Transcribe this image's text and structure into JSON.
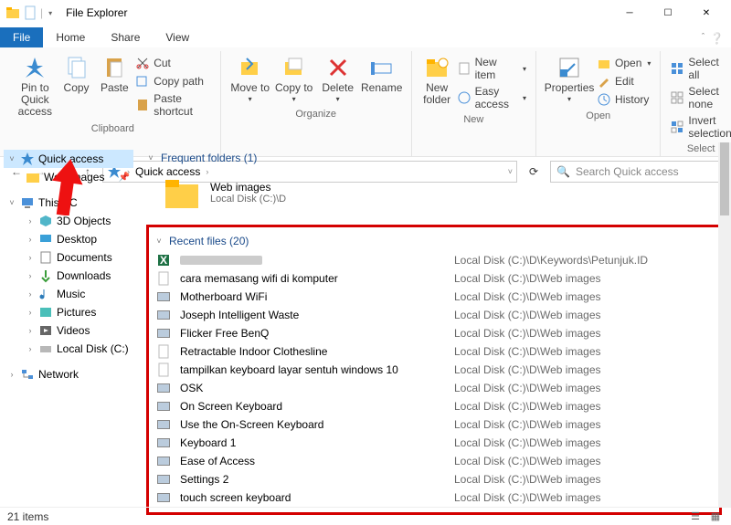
{
  "window": {
    "title": "File Explorer"
  },
  "tabs": {
    "file": "File",
    "home": "Home",
    "share": "Share",
    "view": "View"
  },
  "ribbon": {
    "clipboard": {
      "label": "Clipboard",
      "pin": "Pin to Quick access",
      "copy": "Copy",
      "paste": "Paste",
      "cut": "Cut",
      "copypath": "Copy path",
      "pasteshortcut": "Paste shortcut"
    },
    "organize": {
      "label": "Organize",
      "moveto": "Move to",
      "copyto": "Copy to",
      "delete": "Delete",
      "rename": "Rename"
    },
    "new": {
      "label": "New",
      "newfolder": "New folder",
      "newitem": "New item",
      "easyaccess": "Easy access"
    },
    "open": {
      "label": "Open",
      "properties": "Properties",
      "open": "Open",
      "edit": "Edit",
      "history": "History"
    },
    "select": {
      "label": "Select",
      "selectall": "Select all",
      "selectnone": "Select none",
      "invert": "Invert selection"
    }
  },
  "address": {
    "crumb1": "Quick access"
  },
  "search": {
    "placeholder": "Search Quick access"
  },
  "sidebar": {
    "quickaccess": "Quick access",
    "webimages": "Web images",
    "thispc": "This PC",
    "obj3d": "3D Objects",
    "desktop": "Desktop",
    "documents": "Documents",
    "downloads": "Downloads",
    "music": "Music",
    "pictures": "Pictures",
    "videos": "Videos",
    "localdisk": "Local Disk (C:)",
    "network": "Network"
  },
  "frequent": {
    "header": "Frequent folders (1)",
    "items": [
      {
        "name": "Web images",
        "path": "Local Disk (C:)\\D"
      }
    ]
  },
  "recent": {
    "header": "Recent files (20)",
    "items": [
      {
        "name": "",
        "path": "Local Disk (C:)\\D\\Keywords\\Petunjuk.ID",
        "type": "excel",
        "blurred": true
      },
      {
        "name": "cara memasang wifi di komputer",
        "path": "Local Disk (C:)\\D\\Web images",
        "type": "doc"
      },
      {
        "name": "Motherboard WiFi",
        "path": "Local Disk (C:)\\D\\Web images",
        "type": "img"
      },
      {
        "name": "Joseph Intelligent Waste",
        "path": "Local Disk (C:)\\D\\Web images",
        "type": "img"
      },
      {
        "name": "Flicker Free BenQ",
        "path": "Local Disk (C:)\\D\\Web images",
        "type": "img"
      },
      {
        "name": "Retractable Indoor Clothesline",
        "path": "Local Disk (C:)\\D\\Web images",
        "type": "doc"
      },
      {
        "name": "tampilkan keyboard layar sentuh windows 10",
        "path": "Local Disk (C:)\\D\\Web images",
        "type": "doc"
      },
      {
        "name": "OSK",
        "path": "Local Disk (C:)\\D\\Web images",
        "type": "img"
      },
      {
        "name": "On Screen Keyboard",
        "path": "Local Disk (C:)\\D\\Web images",
        "type": "img"
      },
      {
        "name": "Use the On-Screen Keyboard",
        "path": "Local Disk (C:)\\D\\Web images",
        "type": "img"
      },
      {
        "name": "Keyboard 1",
        "path": "Local Disk (C:)\\D\\Web images",
        "type": "img"
      },
      {
        "name": "Ease of Access",
        "path": "Local Disk (C:)\\D\\Web images",
        "type": "img"
      },
      {
        "name": "Settings 2",
        "path": "Local Disk (C:)\\D\\Web images",
        "type": "img"
      },
      {
        "name": "touch screen keyboard",
        "path": "Local Disk (C:)\\D\\Web images",
        "type": "img"
      }
    ]
  },
  "status": {
    "count": "21 items"
  }
}
